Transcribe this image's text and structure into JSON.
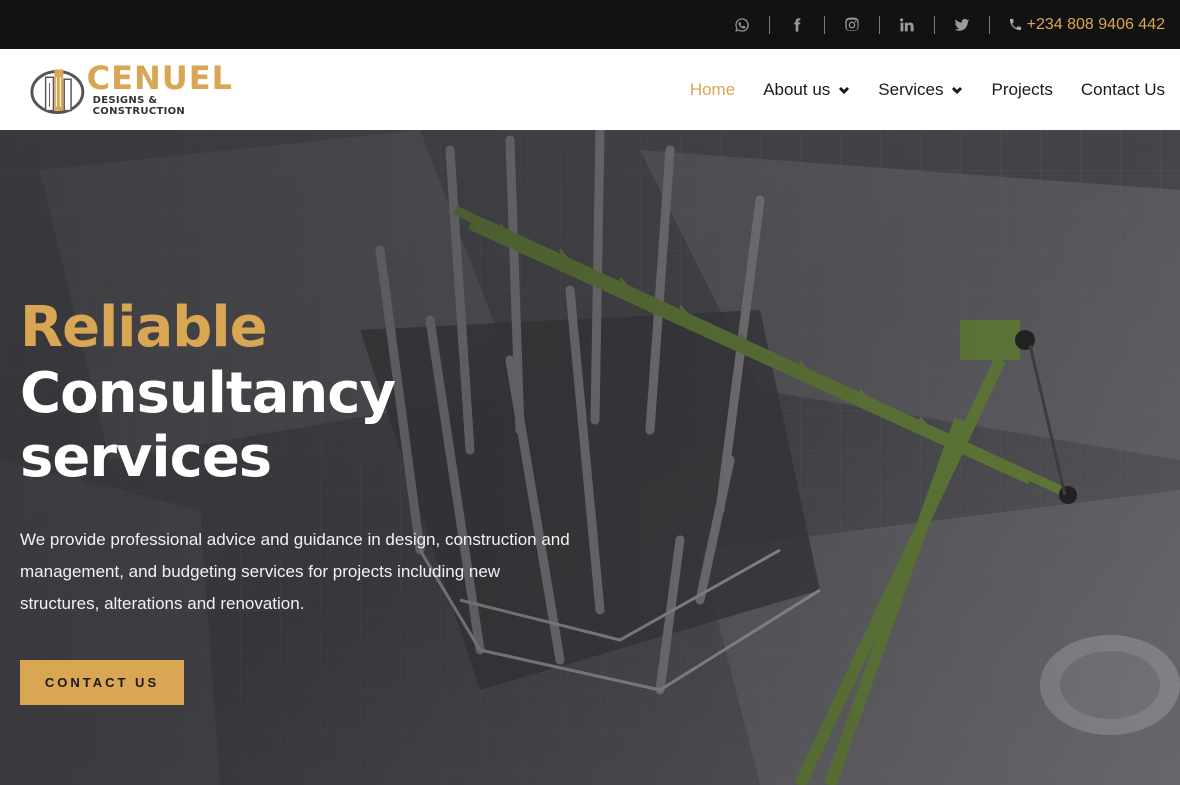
{
  "topbar": {
    "socials": [
      {
        "icon": "whatsapp-icon"
      },
      {
        "icon": "facebook-icon"
      },
      {
        "icon": "instagram-icon"
      },
      {
        "icon": "linkedin-icon"
      },
      {
        "icon": "twitter-icon"
      }
    ],
    "phone": "+234 808 9406 442"
  },
  "logo": {
    "name": "CENUEL",
    "subtitle": "DESIGNS & CONSTRUCTION"
  },
  "nav": {
    "home": "Home",
    "about": "About us",
    "services": "Services",
    "projects": "Projects",
    "contact": "Contact Us"
  },
  "hero": {
    "title_accent": "Reliable",
    "title_main": "Consultancy services",
    "description": "We provide professional advice and guidance in design, construction and management, and budgeting services for projects including new structures, alterations and renovation.",
    "cta": "CONTACT US"
  },
  "colors": {
    "accent": "#d9a653",
    "topbar_bg": "#121212",
    "crane": "#6b8a3a"
  }
}
